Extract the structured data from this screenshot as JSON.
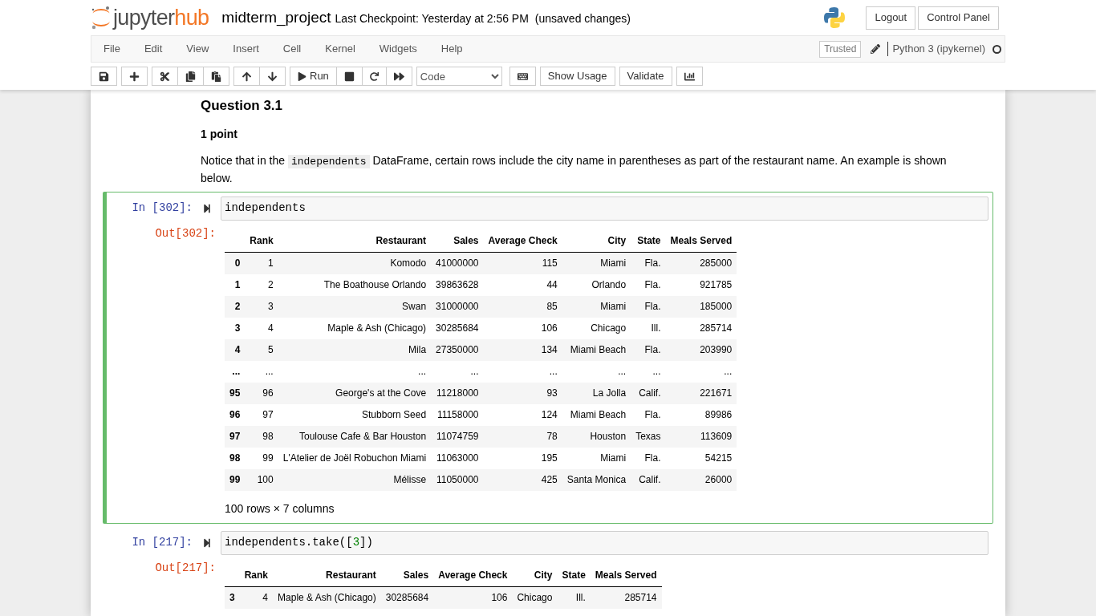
{
  "header": {
    "logo": {
      "first": "jupyter",
      "second": "hub"
    },
    "notebook_name": "midterm_project",
    "checkpoint": "Last Checkpoint: Yesterday at 2:56 PM",
    "save_status": "(unsaved changes)",
    "buttons": [
      "Logout",
      "Control Panel"
    ]
  },
  "menu_bar": {
    "items": [
      "File",
      "Edit",
      "View",
      "Insert",
      "Cell",
      "Kernel",
      "Widgets",
      "Help"
    ],
    "trusted": "Trusted",
    "kernel": "Python 3 (ipykernel)",
    "kernel_busy": false
  },
  "toolbar": {
    "run_label": "Run",
    "cell_type": "Code",
    "buttons": [
      "Show Usage",
      "Validate"
    ]
  },
  "cells": [
    {
      "kind": "markdown",
      "heading": "Question 3.1",
      "points": "1 point",
      "paragraph": [
        {
          "kind": "text",
          "text": "Notice that in the "
        },
        {
          "kind": "code",
          "text": "independents"
        },
        {
          "kind": "text",
          "text": " DataFrame, certain rows include the city name in parentheses as part of the restaurant name. An example is shown below."
        }
      ]
    },
    {
      "kind": "code",
      "selected": true,
      "in_prompt": "In [302]:",
      "code": [
        {
          "kind": "plain",
          "text": "independents"
        }
      ],
      "out_prompt": "Out[302]:",
      "table": {
        "columns": [
          "",
          "Rank",
          "Restaurant",
          "Sales",
          "Average Check",
          "City",
          "State",
          "Meals Served"
        ],
        "rows": [
          [
            "0",
            "1",
            "Komodo",
            "41000000",
            "115",
            "Miami",
            "Fla.",
            "285000"
          ],
          [
            "1",
            "2",
            "The Boathouse Orlando",
            "39863628",
            "44",
            "Orlando",
            "Fla.",
            "921785"
          ],
          [
            "2",
            "3",
            "Swan",
            "31000000",
            "85",
            "Miami",
            "Fla.",
            "185000"
          ],
          [
            "3",
            "4",
            "Maple & Ash (Chicago)",
            "30285684",
            "106",
            "Chicago",
            "Ill.",
            "285714"
          ],
          [
            "4",
            "5",
            "Mila",
            "27350000",
            "134",
            "Miami Beach",
            "Fla.",
            "203990"
          ],
          [
            "...",
            "...",
            "...",
            "...",
            "...",
            "...",
            "...",
            "..."
          ],
          [
            "95",
            "96",
            "George's at the Cove",
            "11218000",
            "93",
            "La Jolla",
            "Calif.",
            "221671"
          ],
          [
            "96",
            "97",
            "Stubborn Seed",
            "11158000",
            "124",
            "Miami Beach",
            "Fla.",
            "89986"
          ],
          [
            "97",
            "98",
            "Toulouse Cafe & Bar Houston",
            "11074759",
            "78",
            "Houston",
            "Texas",
            "113609"
          ],
          [
            "98",
            "99",
            "L'Atelier de Joël Robuchon Miami",
            "11063000",
            "195",
            "Miami",
            "Fla.",
            "54215"
          ],
          [
            "99",
            "100",
            "Mélisse",
            "11050000",
            "425",
            "Santa Monica",
            "Calif.",
            "26000"
          ]
        ],
        "footer": "100 rows × 7 columns"
      }
    },
    {
      "kind": "code",
      "selected": false,
      "in_prompt": "In [217]:",
      "code": [
        {
          "kind": "plain",
          "text": "independents.take(["
        },
        {
          "kind": "number",
          "text": "3"
        },
        {
          "kind": "plain",
          "text": "])"
        }
      ],
      "out_prompt": "Out[217]:",
      "table": {
        "columns": [
          "",
          "Rank",
          "Restaurant",
          "Sales",
          "Average Check",
          "City",
          "State",
          "Meals Served"
        ],
        "rows": [
          [
            "3",
            "4",
            "Maple & Ash (Chicago)",
            "30285684",
            "106",
            "Chicago",
            "Ill.",
            "285714"
          ]
        ]
      }
    }
  ]
}
